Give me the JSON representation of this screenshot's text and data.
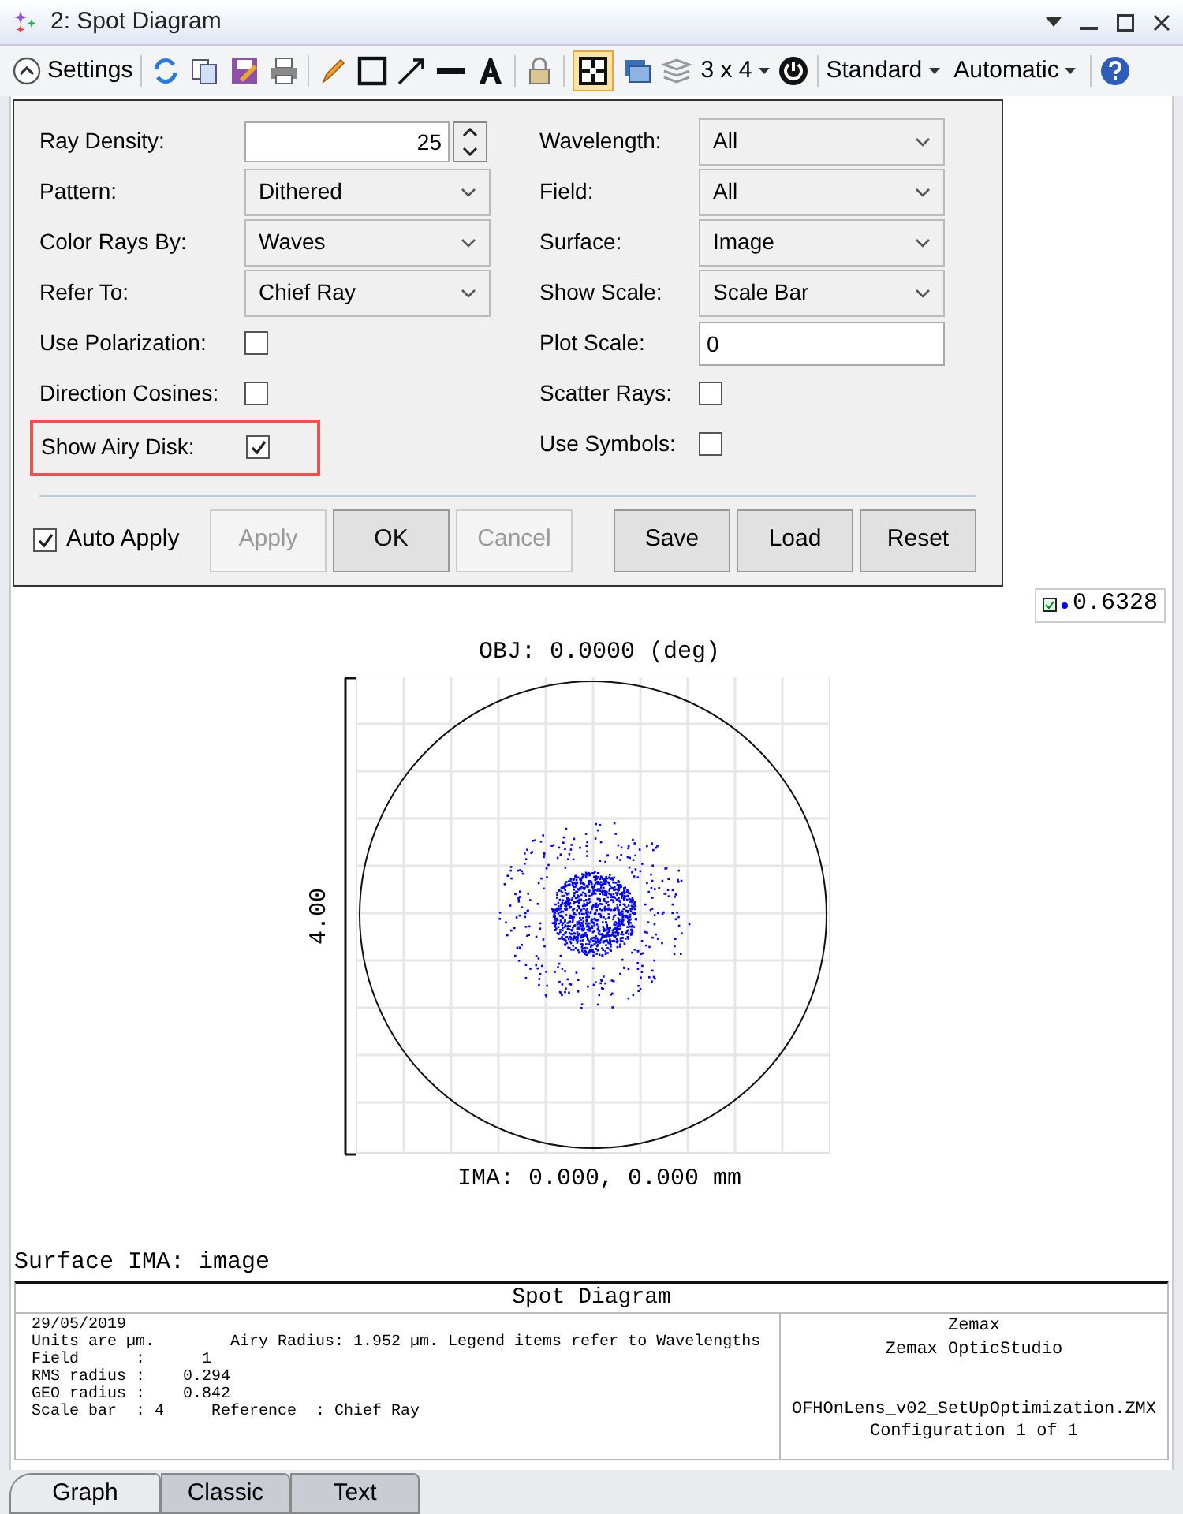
{
  "window": {
    "title": "2: Spot Diagram"
  },
  "toolbar": {
    "settings_label": "Settings",
    "layout": "3 x 4",
    "menus": [
      "Standard",
      "Automatic"
    ]
  },
  "settings": {
    "left": [
      {
        "kind": "number",
        "label": "Ray Density:",
        "value": "25"
      },
      {
        "kind": "select",
        "label": "Pattern:",
        "value": "Dithered"
      },
      {
        "kind": "select",
        "label": "Color Rays By:",
        "value": "Waves"
      },
      {
        "kind": "select",
        "label": "Refer To:",
        "value": "Chief Ray"
      },
      {
        "kind": "checkbox",
        "label": "Use Polarization:",
        "checked": false,
        "highlighted": false
      },
      {
        "kind": "checkbox",
        "label": "Direction Cosines:",
        "checked": false,
        "highlighted": false
      },
      {
        "kind": "checkbox",
        "label": "Show Airy Disk:",
        "checked": true,
        "highlighted": true
      }
    ],
    "right": [
      {
        "kind": "select",
        "label": "Wavelength:",
        "value": "All"
      },
      {
        "kind": "select",
        "label": "Field:",
        "value": "All"
      },
      {
        "kind": "select",
        "label": "Surface:",
        "value": "Image"
      },
      {
        "kind": "select",
        "label": "Show Scale:",
        "value": "Scale Bar"
      },
      {
        "kind": "text",
        "label": "Plot Scale:",
        "value": "0"
      },
      {
        "kind": "checkbox",
        "label": "Scatter Rays:",
        "checked": false,
        "highlighted": false
      },
      {
        "kind": "checkbox",
        "label": "Use Symbols:",
        "checked": false,
        "highlighted": false
      }
    ],
    "auto_apply": {
      "label": "Auto Apply",
      "checked": true
    },
    "buttons": [
      {
        "label": "Apply",
        "disabled": true
      },
      {
        "label": "OK",
        "disabled": false
      },
      {
        "label": "Cancel",
        "disabled": true
      }
    ],
    "file_buttons": [
      {
        "label": "Save"
      },
      {
        "label": "Load"
      },
      {
        "label": "Reset"
      }
    ]
  },
  "legend": {
    "wavelength": "0.6328",
    "color": "#0000ff"
  },
  "plot": {
    "title": "OBJ: 0.0000 (deg)",
    "scale_label": "4.00",
    "image_label": "IMA: 0.000, 0.000 mm",
    "surface_label": "Surface IMA: image"
  },
  "info": {
    "title": "Spot Diagram",
    "lines": [
      "29/05/2019",
      "Units are µm.        Airy Radius: 1.952 µm. Legend items refer to Wavelengths",
      "Field      :      1",
      "RMS radius :    0.294",
      "GEO radius :    0.842",
      "Scale bar  : 4     Reference  : Chief Ray"
    ],
    "company": [
      "Zemax",
      "Zemax OpticStudio"
    ],
    "file": [
      "OFHOnLens_v02_SetUpOptimization.ZMX",
      "Configuration 1 of 1"
    ]
  },
  "tabs": [
    {
      "label": "Graph",
      "selected": true
    },
    {
      "label": "Classic",
      "selected": false
    },
    {
      "label": "Text",
      "selected": false
    }
  ]
}
